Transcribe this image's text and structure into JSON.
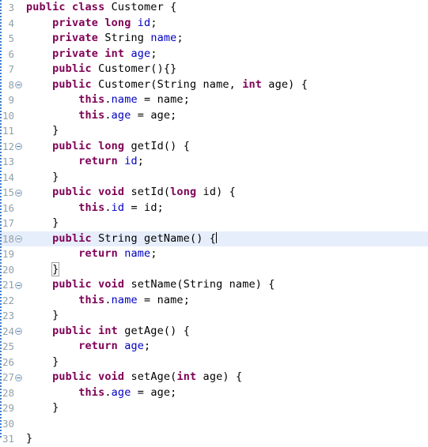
{
  "editor": {
    "name": "java-source-editor",
    "language": "Java",
    "background": "#ffffff",
    "current_line_highlight": "#e6eefb",
    "gutter_text_color": "#919fa8",
    "keyword_color": "#7f0055",
    "field_color": "#0000c0",
    "plain_color": "#000000",
    "caret_color": "#000000",
    "first_visible_line": 3,
    "last_visible_line": 31,
    "cursor": {
      "line": 18,
      "after_text": "{"
    },
    "matching_brace_line": 20
  },
  "lines": [
    {
      "number": "3",
      "fold": false,
      "current": false,
      "tokens": [
        {
          "t": "public",
          "c": "kw"
        },
        {
          "t": " ",
          "c": "pln"
        },
        {
          "t": "class",
          "c": "kw"
        },
        {
          "t": " Customer {",
          "c": "pln"
        }
      ]
    },
    {
      "number": "4",
      "fold": false,
      "current": false,
      "tokens": [
        {
          "t": "    ",
          "c": "pln"
        },
        {
          "t": "private",
          "c": "kw"
        },
        {
          "t": " ",
          "c": "pln"
        },
        {
          "t": "long",
          "c": "kw"
        },
        {
          "t": " ",
          "c": "pln"
        },
        {
          "t": "id",
          "c": "fld"
        },
        {
          "t": ";",
          "c": "pln"
        }
      ]
    },
    {
      "number": "5",
      "fold": false,
      "current": false,
      "tokens": [
        {
          "t": "    ",
          "c": "pln"
        },
        {
          "t": "private",
          "c": "kw"
        },
        {
          "t": " String ",
          "c": "pln"
        },
        {
          "t": "name",
          "c": "fld"
        },
        {
          "t": ";",
          "c": "pln"
        }
      ]
    },
    {
      "number": "6",
      "fold": false,
      "current": false,
      "tokens": [
        {
          "t": "    ",
          "c": "pln"
        },
        {
          "t": "private",
          "c": "kw"
        },
        {
          "t": " ",
          "c": "pln"
        },
        {
          "t": "int",
          "c": "kw"
        },
        {
          "t": " ",
          "c": "pln"
        },
        {
          "t": "age",
          "c": "fld"
        },
        {
          "t": ";",
          "c": "pln"
        }
      ]
    },
    {
      "number": "7",
      "fold": false,
      "current": false,
      "tokens": [
        {
          "t": "    ",
          "c": "pln"
        },
        {
          "t": "public",
          "c": "kw"
        },
        {
          "t": " Customer(){}",
          "c": "pln"
        }
      ]
    },
    {
      "number": "8",
      "fold": true,
      "current": false,
      "tokens": [
        {
          "t": "    ",
          "c": "pln"
        },
        {
          "t": "public",
          "c": "kw"
        },
        {
          "t": " Customer(String name, ",
          "c": "pln"
        },
        {
          "t": "int",
          "c": "kw"
        },
        {
          "t": " age) {",
          "c": "pln"
        }
      ]
    },
    {
      "number": "9",
      "fold": false,
      "current": false,
      "tokens": [
        {
          "t": "        ",
          "c": "pln"
        },
        {
          "t": "this",
          "c": "kw"
        },
        {
          "t": ".",
          "c": "pln"
        },
        {
          "t": "name",
          "c": "fld"
        },
        {
          "t": " = name;",
          "c": "pln"
        }
      ]
    },
    {
      "number": "10",
      "fold": false,
      "current": false,
      "tokens": [
        {
          "t": "        ",
          "c": "pln"
        },
        {
          "t": "this",
          "c": "kw"
        },
        {
          "t": ".",
          "c": "pln"
        },
        {
          "t": "age",
          "c": "fld"
        },
        {
          "t": " = age;",
          "c": "pln"
        }
      ]
    },
    {
      "number": "11",
      "fold": false,
      "current": false,
      "tokens": [
        {
          "t": "    }",
          "c": "pln"
        }
      ]
    },
    {
      "number": "12",
      "fold": true,
      "current": false,
      "tokens": [
        {
          "t": "    ",
          "c": "pln"
        },
        {
          "t": "public",
          "c": "kw"
        },
        {
          "t": " ",
          "c": "pln"
        },
        {
          "t": "long",
          "c": "kw"
        },
        {
          "t": " getId() {",
          "c": "pln"
        }
      ]
    },
    {
      "number": "13",
      "fold": false,
      "current": false,
      "tokens": [
        {
          "t": "        ",
          "c": "pln"
        },
        {
          "t": "return",
          "c": "kw"
        },
        {
          "t": " ",
          "c": "pln"
        },
        {
          "t": "id",
          "c": "fld"
        },
        {
          "t": ";",
          "c": "pln"
        }
      ]
    },
    {
      "number": "14",
      "fold": false,
      "current": false,
      "tokens": [
        {
          "t": "    }",
          "c": "pln"
        }
      ]
    },
    {
      "number": "15",
      "fold": true,
      "current": false,
      "tokens": [
        {
          "t": "    ",
          "c": "pln"
        },
        {
          "t": "public",
          "c": "kw"
        },
        {
          "t": " ",
          "c": "pln"
        },
        {
          "t": "void",
          "c": "kw"
        },
        {
          "t": " setId(",
          "c": "pln"
        },
        {
          "t": "long",
          "c": "kw"
        },
        {
          "t": " id) {",
          "c": "pln"
        }
      ]
    },
    {
      "number": "16",
      "fold": false,
      "current": false,
      "tokens": [
        {
          "t": "        ",
          "c": "pln"
        },
        {
          "t": "this",
          "c": "kw"
        },
        {
          "t": ".",
          "c": "pln"
        },
        {
          "t": "id",
          "c": "fld"
        },
        {
          "t": " = id;",
          "c": "pln"
        }
      ]
    },
    {
      "number": "17",
      "fold": false,
      "current": false,
      "tokens": [
        {
          "t": "    }",
          "c": "pln"
        }
      ]
    },
    {
      "number": "18",
      "fold": true,
      "current": true,
      "caret_after": true,
      "tokens": [
        {
          "t": "    ",
          "c": "pln"
        },
        {
          "t": "public",
          "c": "kw"
        },
        {
          "t": " String getName() {",
          "c": "pln"
        }
      ]
    },
    {
      "number": "19",
      "fold": false,
      "current": false,
      "tokens": [
        {
          "t": "        ",
          "c": "pln"
        },
        {
          "t": "return",
          "c": "kw"
        },
        {
          "t": " ",
          "c": "pln"
        },
        {
          "t": "name",
          "c": "fld"
        },
        {
          "t": ";",
          "c": "pln"
        }
      ]
    },
    {
      "number": "20",
      "fold": false,
      "current": false,
      "brace_match": true,
      "tokens": [
        {
          "t": "    ",
          "c": "pln"
        },
        {
          "t": "}",
          "c": "pln",
          "box": true
        }
      ]
    },
    {
      "number": "21",
      "fold": true,
      "current": false,
      "tokens": [
        {
          "t": "    ",
          "c": "pln"
        },
        {
          "t": "public",
          "c": "kw"
        },
        {
          "t": " ",
          "c": "pln"
        },
        {
          "t": "void",
          "c": "kw"
        },
        {
          "t": " setName(String name) {",
          "c": "pln"
        }
      ]
    },
    {
      "number": "22",
      "fold": false,
      "current": false,
      "tokens": [
        {
          "t": "        ",
          "c": "pln"
        },
        {
          "t": "this",
          "c": "kw"
        },
        {
          "t": ".",
          "c": "pln"
        },
        {
          "t": "name",
          "c": "fld"
        },
        {
          "t": " = name;",
          "c": "pln"
        }
      ]
    },
    {
      "number": "23",
      "fold": false,
      "current": false,
      "tokens": [
        {
          "t": "    }",
          "c": "pln"
        }
      ]
    },
    {
      "number": "24",
      "fold": true,
      "current": false,
      "tokens": [
        {
          "t": "    ",
          "c": "pln"
        },
        {
          "t": "public",
          "c": "kw"
        },
        {
          "t": " ",
          "c": "pln"
        },
        {
          "t": "int",
          "c": "kw"
        },
        {
          "t": " getAge() {",
          "c": "pln"
        }
      ]
    },
    {
      "number": "25",
      "fold": false,
      "current": false,
      "tokens": [
        {
          "t": "        ",
          "c": "pln"
        },
        {
          "t": "return",
          "c": "kw"
        },
        {
          "t": " ",
          "c": "pln"
        },
        {
          "t": "age",
          "c": "fld"
        },
        {
          "t": ";",
          "c": "pln"
        }
      ]
    },
    {
      "number": "26",
      "fold": false,
      "current": false,
      "tokens": [
        {
          "t": "    }",
          "c": "pln"
        }
      ]
    },
    {
      "number": "27",
      "fold": true,
      "current": false,
      "tokens": [
        {
          "t": "    ",
          "c": "pln"
        },
        {
          "t": "public",
          "c": "kw"
        },
        {
          "t": " ",
          "c": "pln"
        },
        {
          "t": "void",
          "c": "kw"
        },
        {
          "t": " setAge(",
          "c": "pln"
        },
        {
          "t": "int",
          "c": "kw"
        },
        {
          "t": " age) {",
          "c": "pln"
        }
      ]
    },
    {
      "number": "28",
      "fold": false,
      "current": false,
      "tokens": [
        {
          "t": "        ",
          "c": "pln"
        },
        {
          "t": "this",
          "c": "kw"
        },
        {
          "t": ".",
          "c": "pln"
        },
        {
          "t": "age",
          "c": "fld"
        },
        {
          "t": " = age;",
          "c": "pln"
        }
      ]
    },
    {
      "number": "29",
      "fold": false,
      "current": false,
      "tokens": [
        {
          "t": "    }",
          "c": "pln"
        }
      ]
    },
    {
      "number": "30",
      "fold": false,
      "current": false,
      "tokens": [
        {
          "t": "",
          "c": "pln"
        }
      ]
    },
    {
      "number": "31",
      "fold": false,
      "current": false,
      "tokens": [
        {
          "t": "}",
          "c": "pln"
        }
      ]
    }
  ]
}
